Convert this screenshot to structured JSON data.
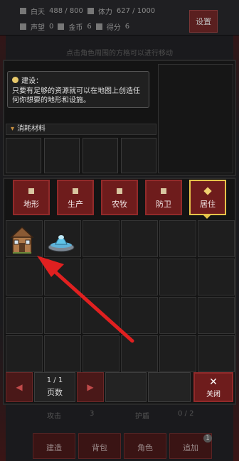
{
  "top": {
    "day_label": "白天",
    "day_value": "488 / 800",
    "stamina_label": "体力",
    "stamina_value": "627 / 1000",
    "reputation_label": "声望",
    "reputation_value": "0",
    "gold_label": "金币",
    "gold_value": "6",
    "score_label": "得分",
    "score_value": "6",
    "settings_label": "设置"
  },
  "hint": "点击角色周围的方格可以进行移动",
  "tip": {
    "title": "建设：",
    "text": "只要有足够的资源就可以在地图上创造任何你想要的地形和设施。"
  },
  "materials_header": "消耗材料",
  "categories": [
    {
      "label": "地形",
      "icon": "terrain-icon"
    },
    {
      "label": "生产",
      "icon": "anvil-icon"
    },
    {
      "label": "农牧",
      "icon": "farm-icon"
    },
    {
      "label": "防卫",
      "icon": "shield-icon"
    },
    {
      "label": "居住",
      "icon": "home-icon"
    }
  ],
  "active_category": "居住",
  "items": [
    {
      "name": "house",
      "icon": "wooden-house-icon"
    },
    {
      "name": "fountain",
      "icon": "fountain-icon"
    }
  ],
  "pager": {
    "prev_icon": "triangle-left-icon",
    "next_icon": "triangle-right-icon",
    "page": "1 / 1",
    "label": "页数"
  },
  "close": {
    "symbol": "✕",
    "label": "关闭"
  },
  "under_row": {
    "left": "攻击",
    "left_val": "3",
    "right": "护盾",
    "right_val": "0 / 2"
  },
  "nav": [
    "建造",
    "背包",
    "角色",
    "追加"
  ],
  "nav_badge": "1",
  "colors": {
    "button_red": "#6e1c1c",
    "active_border": "#e6c34a",
    "arrow_red": "#e02020"
  }
}
